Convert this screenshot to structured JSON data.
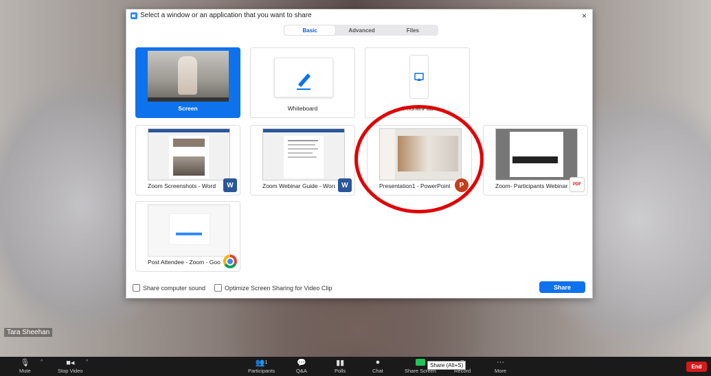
{
  "dialog": {
    "title": "Select a window or an application that you want to share",
    "close": "×",
    "tabs": [
      "Basic",
      "Advanced",
      "Files"
    ],
    "tiles": [
      {
        "label": "Screen",
        "app": ""
      },
      {
        "label": "Whiteboard",
        "app": ""
      },
      {
        "label": "iPhone/iPad",
        "app": ""
      },
      {
        "label": "Zoom Screenshots - Word",
        "app": "W"
      },
      {
        "label": "Zoom Webinar Guide - Word",
        "app": "W"
      },
      {
        "label": "Presentation1 - PowerPoint",
        "app": "P"
      },
      {
        "label": "Zoom- Participants Webinar Instr...",
        "app": "PDF"
      },
      {
        "label": "Post Attendee - Zoom - Google ...",
        "app": ""
      }
    ],
    "share_sound": "Share computer sound",
    "optimize": "Optimize Screen Sharing for Video Clip",
    "share_button": "Share"
  },
  "participant_name": "Tara Sheehan",
  "toolbar": {
    "mute": "Mute",
    "stop_video": "Stop Video",
    "participants": "Participants",
    "participants_count": "1",
    "qa": "Q&A",
    "polls": "Polls",
    "chat": "Chat",
    "share_screen": "Share Screen",
    "record": "Record",
    "more": "More",
    "end": "End",
    "tooltip": "Share (Alt+S)"
  },
  "colors": {
    "accent": "#0e72ed",
    "end": "#d31b1b",
    "highlight": "#e00000"
  }
}
